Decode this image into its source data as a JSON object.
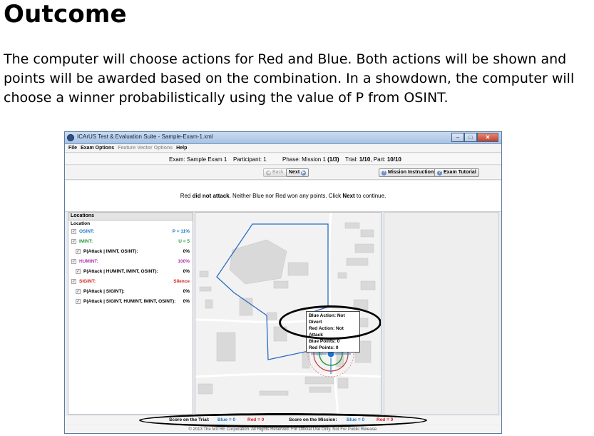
{
  "slide": {
    "title": "Outcome",
    "body": "The computer will choose actions for Red and Blue. Both actions will be shown and points will be awarded based on the combination. In a showdown, the computer will choose a winner probabilistically using the value of P from OSINT."
  },
  "window": {
    "title": "ICArUS Test & Evaluation Suite - Sample-Exam-1.xml",
    "menu": [
      "File",
      "Exam Options",
      "Feature Vector Options",
      "Help"
    ]
  },
  "info": {
    "exam": "Exam: Sample Exam 1",
    "participant": "Participant: 1",
    "phase_prefix": "Phase: Mission 1 ",
    "phase_bold": "(1/3)",
    "trial_prefix": "Trial: ",
    "trial_bold": "1/10",
    "part_prefix": ", Part: ",
    "part_bold": "10/10"
  },
  "nav": {
    "back": "Back",
    "next": "Next",
    "mission_instructions": "Mission Instructions",
    "exam_tutorial": "Exam Tutorial"
  },
  "message": {
    "part1": "Red ",
    "bold1": "did not attack",
    "part2": ". Neither Blue nor Red won any points. Click ",
    "bold2": "Next",
    "part3": " to continue."
  },
  "locations": {
    "header": "Locations",
    "subheader": "Location",
    "rows": [
      {
        "label": "OSINT:",
        "value": "P = 11%",
        "color": "#1f77c8"
      },
      {
        "label": "IMINT:",
        "value": "U = 5",
        "color": "#2a9a3a"
      },
      {
        "label": "P(Attack | IMINT, OSINT):",
        "value": "0%",
        "color": "#000000"
      },
      {
        "label": "HUMINT:",
        "value": "100%",
        "color": "#b233b2"
      },
      {
        "label": "P(Attack | HUMINT, IMINT, OSINT):",
        "value": "0%",
        "color": "#000000"
      },
      {
        "label": "SIGINT:",
        "value": "Silence",
        "color": "#d42020"
      },
      {
        "label": "P(Attack | SIGINT):",
        "value": "0%",
        "color": "#000000"
      },
      {
        "label": "P(Attack | SIGINT, HUMINT, IMINT, OSINT):",
        "value": "0%",
        "color": "#000000"
      }
    ]
  },
  "map": {
    "popup": {
      "blue_action": "Blue Action: Not Divert",
      "red_action": "Red Action: Not Attack",
      "blue_points": "Blue Points: 0",
      "red_points": "Red Points: 0"
    }
  },
  "scores": {
    "trial_label": "Score on the Trial:",
    "trial_blue": "Blue = 0",
    "trial_red": "Red = 0",
    "mission_label": "Score on the Mission:",
    "mission_blue": "Blue = 0",
    "mission_red": "Red = 0"
  },
  "copyright": "© 2013 The MITRE Corporation. All Rights Reserved. For Official Use Only. Not For Public Release."
}
